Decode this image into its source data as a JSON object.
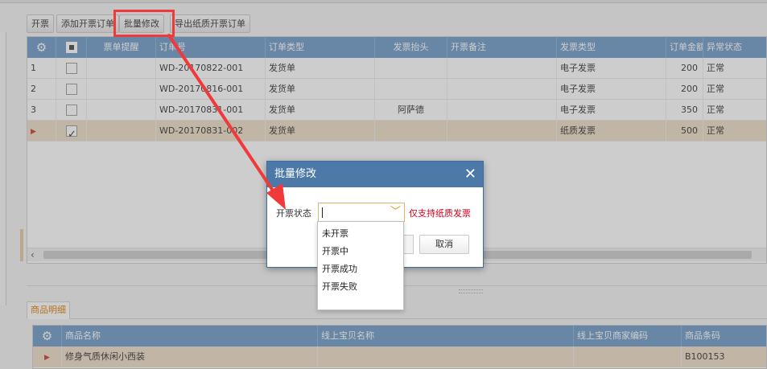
{
  "toolbar": {
    "invoice_label": "开票",
    "add_order_label": "添加开票订单",
    "batch_edit_label": "批量修改",
    "export_paper_label": "导出纸质开票订单"
  },
  "orders": {
    "columns": [
      "票单提醒",
      "订单号",
      "订单类型",
      "发票抬头",
      "开票备注",
      "发票类型",
      "订单金额",
      "异常状态"
    ],
    "rows": [
      {
        "num": "1",
        "order_no": "WD-20170822-001",
        "type": "发货单",
        "title": "",
        "remark": "",
        "invoice_type": "电子发票",
        "amount": "200",
        "status": "正常",
        "checked": false,
        "selected": false
      },
      {
        "num": "2",
        "order_no": "WD-20170816-001",
        "type": "发货单",
        "title": "",
        "remark": "",
        "invoice_type": "电子发票",
        "amount": "200",
        "status": "正常",
        "checked": false,
        "selected": false
      },
      {
        "num": "3",
        "order_no": "WD-20170831-001",
        "type": "发货单",
        "title": "阿萨德",
        "remark": "",
        "invoice_type": "电子发票",
        "amount": "350",
        "status": "正常",
        "checked": false,
        "selected": false
      },
      {
        "num": "",
        "order_no": "WD-20170831-002",
        "type": "发货单",
        "title": "",
        "remark": "",
        "invoice_type": "纸质发票",
        "amount": "500",
        "status": "正常",
        "checked": true,
        "selected": true
      }
    ]
  },
  "detail": {
    "tab_label": "商品明细",
    "columns": [
      "商品名称",
      "线上宝贝名称",
      "线上宝贝商家编码",
      "商品条码"
    ],
    "rows": [
      {
        "name": "修身气质休闲小西装",
        "online_name": "",
        "online_code": "",
        "barcode": "B100153"
      }
    ]
  },
  "dialog": {
    "title": "批量修改",
    "field_label": "开票状态",
    "hint": "仅支持纸质发票",
    "cancel_label": "取消",
    "options": [
      "未开票",
      "开票中",
      "开票成功",
      "开票失败"
    ]
  },
  "colors": {
    "header_blue": "#6f9ac6",
    "dialog_title_blue": "#4c79a7",
    "selected_row": "#eedec7",
    "annotation_red": "#f03a3a",
    "hint_red": "#d0021b"
  }
}
